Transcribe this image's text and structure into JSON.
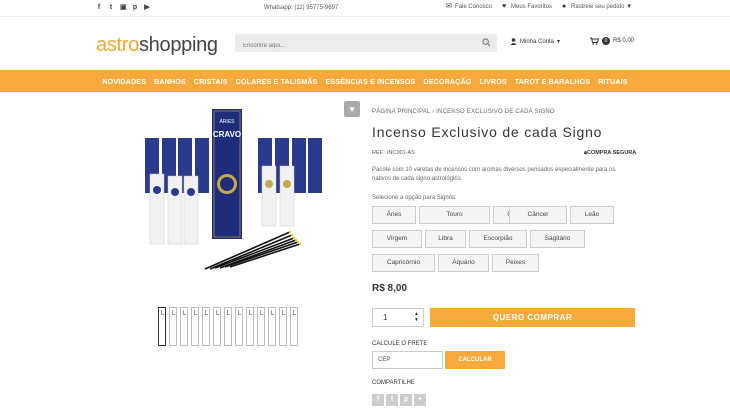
{
  "topbar": {
    "social_icons": [
      "facebook-icon",
      "twitter-icon",
      "instagram-icon",
      "pinterest-icon",
      "youtube-icon"
    ],
    "whatsapp": "Whatsapp: (11) 95775-9697",
    "fale_conosco": "Fale Conosco",
    "favoritos": "Meus Favoritos",
    "rastreie": "Rastreie seu pedido"
  },
  "header": {
    "logo_part1": "astro",
    "logo_part2": "shopping",
    "search_placeholder": "Encontre aqui...",
    "account": "Minha Conta",
    "cart_count": "0",
    "cart_total": "R$ 0,00"
  },
  "nav": [
    "NOVIDADES",
    "BANHOS",
    "CRISTAIS",
    "COLARES E TALISMÃS",
    "ESSÊNCIAS E INCENSOS",
    "DECORAÇÃO",
    "LIVROS",
    "TAROT E BARALHOS",
    "RITUAIS"
  ],
  "product": {
    "breadcrumb_home": "PÁGINA PRINCIPAL",
    "breadcrumb_sep": "›",
    "breadcrumb_current": "INCENSO EXCLUSIVO DE CADA SIGNO",
    "title": "Incenso Exclusivo de cada Signo",
    "ref": "REF.: INC001-AS",
    "secure": "COMPRA SEGURA",
    "description": "Pacote com 10 varetas de incensos com aromas diversos pensados especialmente para os nativos de cada signo astrológico.",
    "select_label": "Selecione a opção para Signos:",
    "options": [
      "Áries",
      "Touro",
      "Gêmeos",
      "Câncer",
      "Leão",
      "Virgem",
      "Libra",
      "Escorpião",
      "Sagitário",
      "Capricórnio",
      "Aquário",
      "Peixes"
    ],
    "price": "R$ 8,00",
    "quantity": "1",
    "buy_label": "QUERO COMPRAR",
    "freight_label": "CALCULE O FRETE",
    "cep_placeholder": "CEP",
    "calc_label": "CALCULAR",
    "share_label": "COMPARTILHE",
    "image_labels": {
      "box_main_sign": "ÁRIES",
      "box_main_aroma": "CRAVO"
    }
  },
  "colors": {
    "accent": "#f7a93b",
    "nav_text": "#ffffff",
    "box_blue": "#2a3a8c"
  }
}
